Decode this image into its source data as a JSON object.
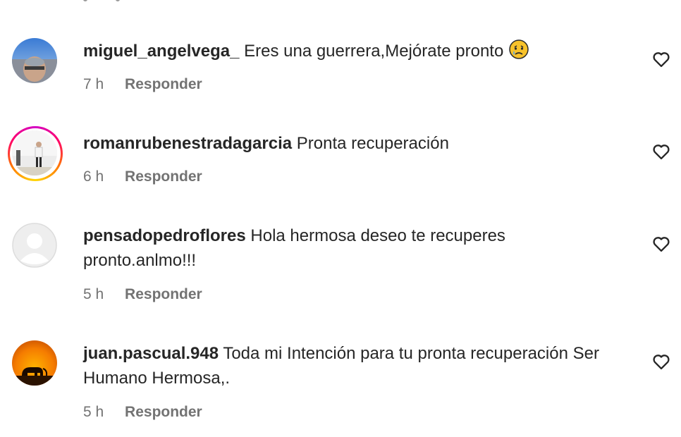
{
  "comments": [
    {
      "username": "miguel_angelvega_",
      "text": "Eres una guerrera,Mejórate pronto",
      "emoji": "crying-face-icon",
      "time": "7 h",
      "reply": "Responder"
    },
    {
      "username": "romanrubenestradagarcia",
      "text": "Pronta recuperación",
      "time": "6 h",
      "reply": "Responder"
    },
    {
      "username": "pensadopedroflores",
      "text": "Hola hermosa deseo te recuperes pronto.anlmo!!!",
      "time": "5 h",
      "reply": "Responder"
    },
    {
      "username": "juan.pascual.948",
      "text": "Toda mi Intención para tu pronta recuperación Ser Humano Hermosa,.",
      "time": "5 h",
      "reply": "Responder"
    }
  ],
  "colors": {
    "text": "#262626",
    "muted": "#737373",
    "story_ring": "#ff0069"
  }
}
